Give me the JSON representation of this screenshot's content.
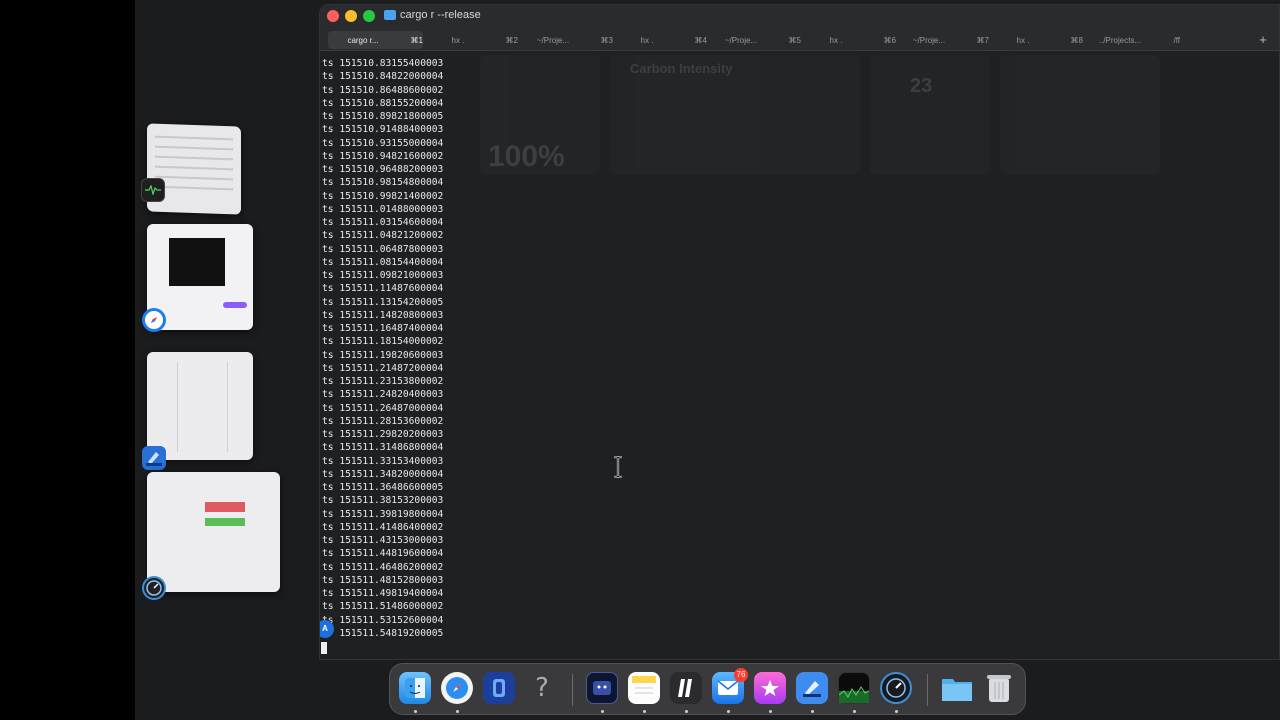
{
  "window": {
    "title": "cargo r --release"
  },
  "tabs": [
    {
      "label": "cargo r...",
      "key": "⌘1",
      "active": true
    },
    {
      "label": "hx .",
      "key": "⌘2"
    },
    {
      "label": "~/Proje...",
      "key": "⌘3"
    },
    {
      "label": "hx .",
      "key": "⌘4"
    },
    {
      "label": "~/Proje...",
      "key": "⌘5"
    },
    {
      "label": "hx .",
      "key": "⌘6"
    },
    {
      "label": "~/Proje...",
      "key": "⌘7"
    },
    {
      "label": "hx .",
      "key": "⌘8"
    },
    {
      "label": "../Projects...",
      "key": "/ff"
    }
  ],
  "new_tab_label": "+",
  "ghost_widget": {
    "percent": "100%",
    "title": "Carbon Intensity",
    "number": "23"
  },
  "output_lines": [
    "ts 151510.83155400003",
    "ts 151510.84822000004",
    "ts 151510.86488600002",
    "ts 151510.88155200004",
    "ts 151510.89821800005",
    "ts 151510.91488400003",
    "ts 151510.93155000004",
    "ts 151510.94821600002",
    "ts 151510.96488200003",
    "ts 151510.98154800004",
    "ts 151510.99821400002",
    "ts 151511.01488000003",
    "ts 151511.03154600004",
    "ts 151511.04821200002",
    "ts 151511.06487800003",
    "ts 151511.08154400004",
    "ts 151511.09821000003",
    "ts 151511.11487600004",
    "ts 151511.13154200005",
    "ts 151511.14820800003",
    "ts 151511.16487400004",
    "ts 151511.18154000002",
    "ts 151511.19820600003",
    "ts 151511.21487200004",
    "ts 151511.23153800002",
    "ts 151511.24820400003",
    "ts 151511.26487000004",
    "ts 151511.28153600002",
    "ts 151511.29820200003",
    "ts 151511.31486800004",
    "ts 151511.33153400003",
    "ts 151511.34820000004",
    "ts 151511.36486600005",
    "ts 151511.38153200003",
    "ts 151511.39819800004",
    "ts 151511.41486400002",
    "ts 151511.43153000003",
    "ts 151511.44819600004",
    "ts 151511.46486200002",
    "ts 151511.48152800003",
    "ts 151511.49819400004",
    "ts 151511.51486000002",
    "ts 151511.53152600004",
    "   151511.54819200005"
  ],
  "input_badge": "A",
  "dock": {
    "mail_badge": "76",
    "items": [
      "finder",
      "safari",
      "blue-app",
      "help",
      "terminal-app",
      "notes",
      "helix",
      "mail",
      "reeder",
      "xcode-beta",
      "activity-monitor",
      "instruments-beta",
      "downloads-folder",
      "trash"
    ]
  },
  "colors": {
    "terminal_bg": "#1f2022",
    "text": "#e8e8e8",
    "accent": "#1e6fe0"
  }
}
